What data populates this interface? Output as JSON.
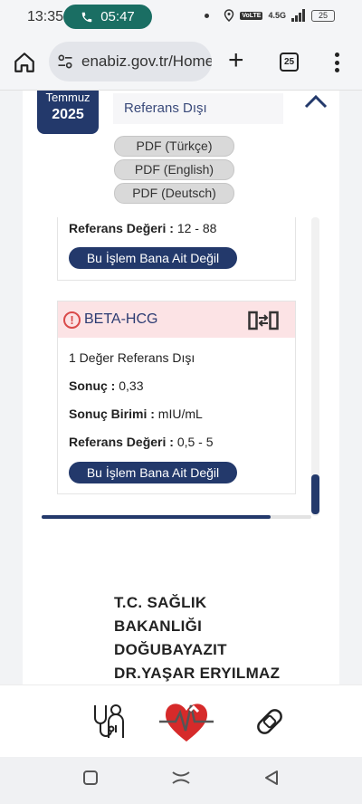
{
  "status_bar": {
    "time": "13:35",
    "call_time": "05:47",
    "network": "4.5G",
    "volte": "VoLTE",
    "battery": "25"
  },
  "browser": {
    "url": "enabiz.gov.tr/Home",
    "tab_count": "25"
  },
  "record": {
    "month": "Temmuz",
    "year": "2025",
    "status_label": "Referans Dışı",
    "pdf_buttons": [
      "PDF (Türkçe)",
      "PDF (English)",
      "PDF (Deutsch)"
    ],
    "prev_result": {
      "ref_label": "Referans Değeri :",
      "ref_value": "12 - 88",
      "button": "Bu İşlem Bana Ait Değil"
    },
    "test": {
      "name": "BETA-HCG",
      "summary": "1 Değer Referans Dışı",
      "result_label": "Sonuç :",
      "result_value": "0,33",
      "unit_label": "Sonuç Birimi :",
      "unit_value": "mIU/mL",
      "ref_label": "Referans Değeri :",
      "ref_value": "0,5 - 5",
      "button": "Bu İşlem Bana Ait Değil"
    }
  },
  "hospital": {
    "lines": [
      "T.C. SAĞLIK",
      "BAKANLIĞI",
      "DOĞUBAYAZIT",
      "DR.YAŞAR ERYILMAZ"
    ]
  },
  "colors": {
    "primary": "#23396b",
    "alert_bg": "#fce3e5",
    "alert_icon": "#d94a4a",
    "call_pill": "#1a6e63"
  },
  "icons": {
    "nav": [
      "doctor-icon",
      "heart-logo-icon",
      "bandage-icon"
    ]
  }
}
